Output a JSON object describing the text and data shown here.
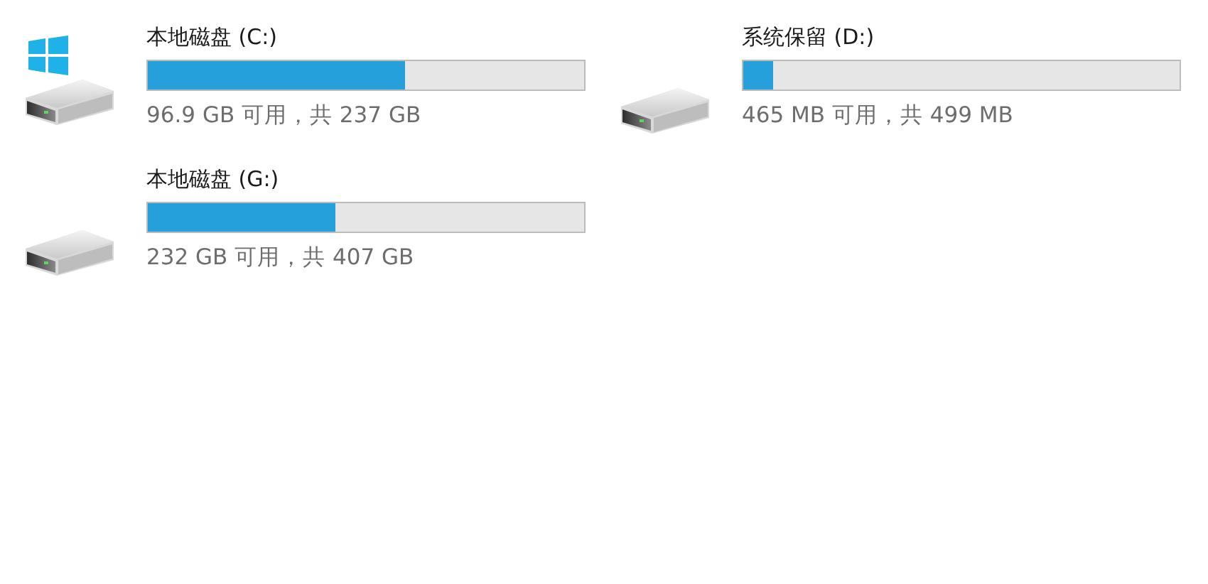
{
  "drives": [
    {
      "name": "本地磁盘 (C:)",
      "kind": "system",
      "level": 0.59,
      "caption": "96.9 GB 可用，共 237 GB"
    },
    {
      "name": "系统保留 (D:)",
      "kind": "local",
      "level": 0.07,
      "caption": "465 MB 可用，共 499 MB"
    },
    {
      "name": "本地磁盘 (G:)",
      "kind": "local",
      "level": 0.43,
      "caption": "232 GB 可用，共 407 GB"
    }
  ]
}
